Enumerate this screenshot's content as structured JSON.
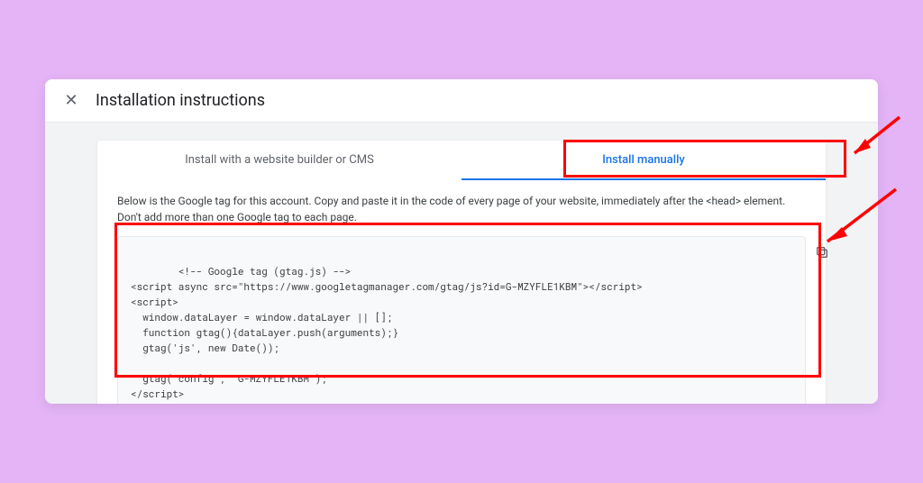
{
  "header": {
    "title": "Installation instructions"
  },
  "tabs": {
    "cms_label": "Install with a website builder or CMS",
    "manual_label": "Install manually"
  },
  "body": {
    "desc": "Below is the Google tag for this account. Copy and paste it in the code of every page of your website, immediately after the <head> element. Don't add more than one Google tag to each page.",
    "code": "<!-- Google tag (gtag.js) -->\n<script async src=\"https://www.googletagmanager.com/gtag/js?id=G-MZYFLE1KBM\"></script>\n<script>\n  window.dataLayer = window.dataLayer || [];\n  function gtag(){dataLayer.push(arguments);}\n  gtag('js', new Date());\n\n  gtag('config', 'G-MZYFLE1KBM');\n</script>"
  }
}
